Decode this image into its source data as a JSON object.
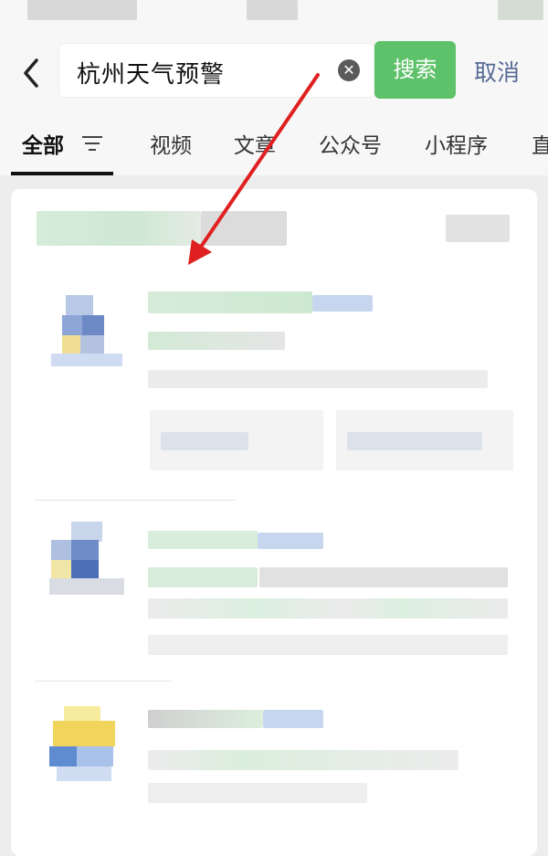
{
  "search": {
    "query": "杭州天气预警",
    "search_label": "搜索",
    "cancel_label": "取消"
  },
  "tabs": [
    {
      "label": "全部",
      "active": true
    },
    {
      "label": "视频"
    },
    {
      "label": "文章"
    },
    {
      "label": "公众号"
    },
    {
      "label": "小程序"
    },
    {
      "label": "直"
    }
  ],
  "icons": {
    "back": "chevron-left-icon",
    "clear": "clear-circle-icon",
    "filter": "filter-icon"
  },
  "colors": {
    "accent_green": "#5ec26a",
    "link_blue": "#576b95",
    "annotation_red": "#e02020"
  }
}
